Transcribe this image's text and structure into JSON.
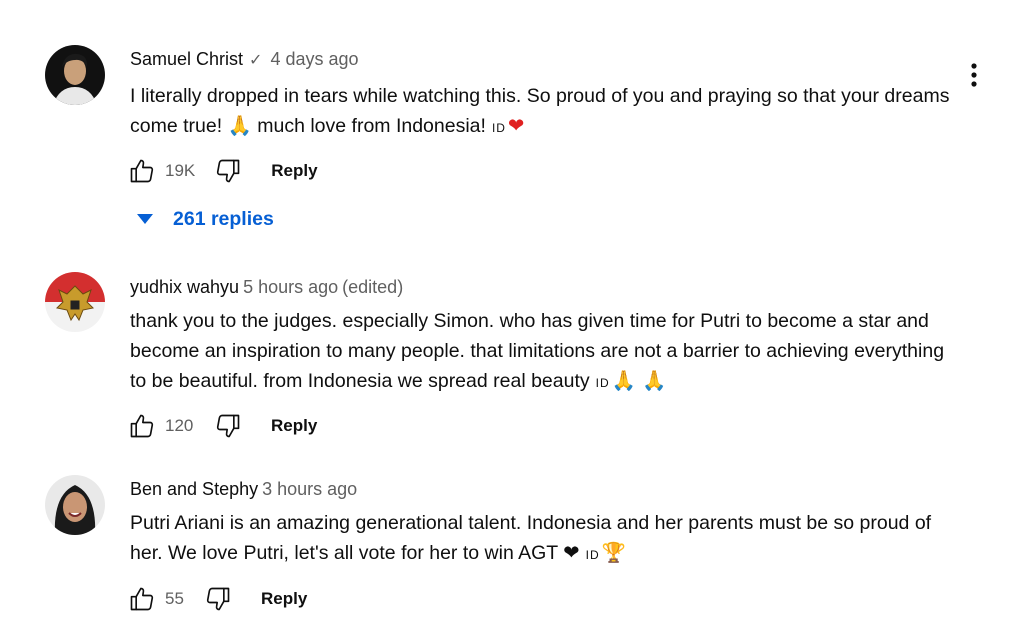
{
  "comments": [
    {
      "author": "Samuel Christ",
      "verified_mark": "✓",
      "time": "4 days ago",
      "edited": "",
      "text": "I literally dropped in tears while watching this. So proud of you and praying so that your dreams come true! 🙏 much love from Indonesia!",
      "flag_text": "ID",
      "trailing_emoji": "❤",
      "likes": "19K",
      "reply_label": "Reply",
      "replies_label": "261 replies"
    },
    {
      "author": "yudhix wahyu",
      "time": "5 hours ago",
      "edited": "(edited)",
      "text": "thank you to the judges. especially Simon. who has given time for Putri to become a star and become an inspiration to many people. that limitations are not a barrier to achieving everything to be beautiful. from Indonesia we spread real beauty",
      "flag_text": "ID",
      "trailing_emoji": "🙏 🙏",
      "likes": "120",
      "reply_label": "Reply"
    },
    {
      "author": "Ben and Stephy",
      "time": "3 hours ago",
      "edited": "",
      "text": "Putri Ariani is an amazing generational talent. Indonesia and her parents must be so proud of her. We love Putri, let's all vote for her to win AGT ❤",
      "flag_text": "ID",
      "trailing_emoji": "🏆",
      "likes": "55",
      "reply_label": "Reply"
    }
  ],
  "icons": {
    "like": "thumb-up-icon",
    "dislike": "thumb-down-icon",
    "more": "more-vertical-icon",
    "expand": "caret-down-icon"
  },
  "colors": {
    "link_blue": "#065fd4",
    "meta_gray": "#606060",
    "heart_red": "#e02020"
  }
}
